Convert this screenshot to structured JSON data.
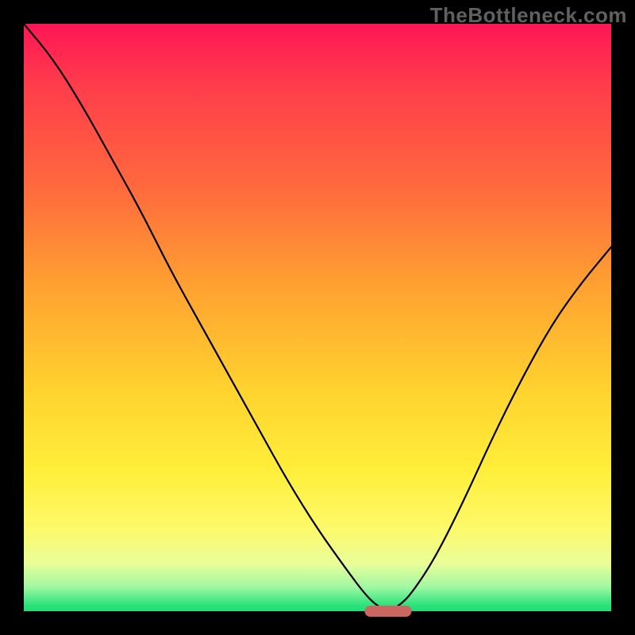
{
  "watermark": "TheBottleneck.com",
  "colors": {
    "frame_bg": "#000000",
    "curve": "#000000",
    "marker": "#cc6661",
    "gradient_stops": [
      "#ff1555",
      "#ff3b4c",
      "#ff6a3d",
      "#ffa231",
      "#ffd22e",
      "#ffee3a",
      "#fdf96a",
      "#e9fe9a",
      "#9cf7a3",
      "#2be27a",
      "#1fdc76"
    ]
  },
  "chart_data": {
    "type": "line",
    "title": "",
    "xlabel": "",
    "ylabel": "",
    "xlim": [
      0,
      100
    ],
    "ylim": [
      0,
      100
    ],
    "x": [
      0,
      5,
      10,
      15,
      20,
      25,
      30,
      35,
      40,
      45,
      50,
      55,
      58,
      60,
      62,
      64,
      66,
      70,
      75,
      80,
      85,
      90,
      95,
      100
    ],
    "values": [
      100,
      94,
      86,
      77,
      68,
      58,
      49,
      40,
      31,
      22,
      14,
      7,
      3,
      1,
      0,
      1,
      3,
      9,
      19,
      30,
      40,
      49,
      56,
      62
    ],
    "minimum_x": 62,
    "marker": {
      "x_center": 62,
      "x_half_width": 4,
      "y": 0
    },
    "notes": "V-shaped bottleneck curve; y is bottleneck percentage (0 at optimum), background gradient encodes same scale (green=0, red=100)."
  }
}
